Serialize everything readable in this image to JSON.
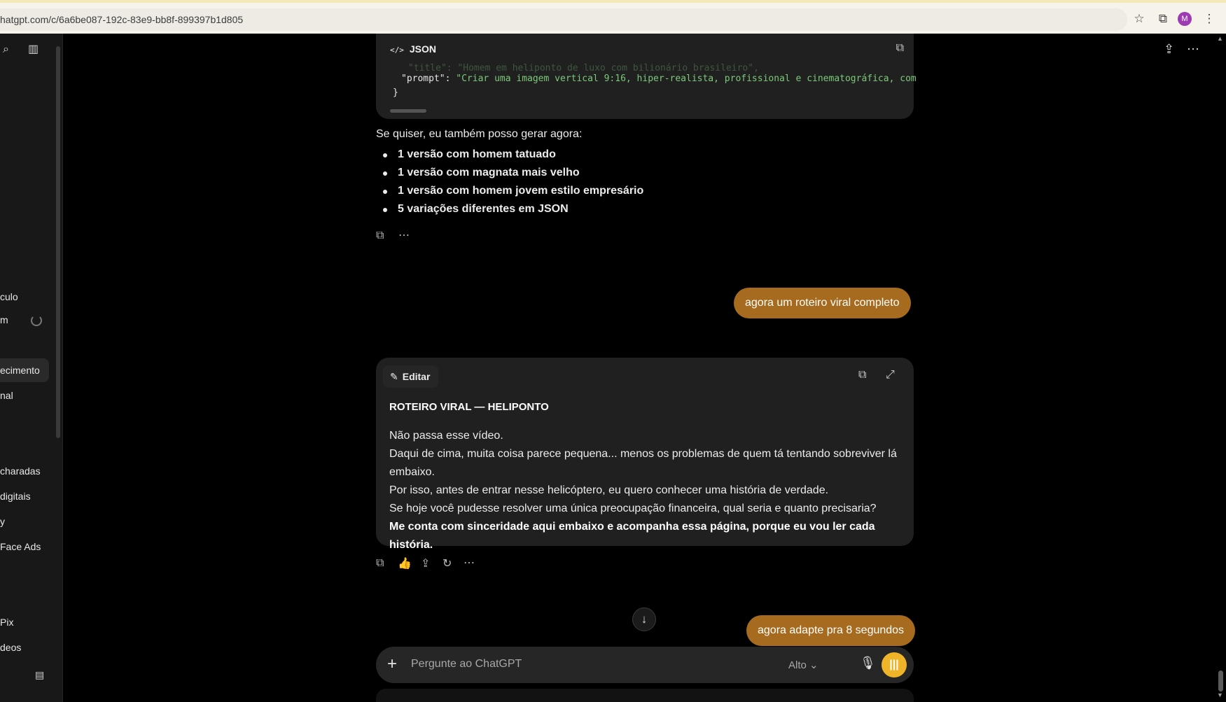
{
  "browser": {
    "url": "hatgpt.com/c/6a6be087-192c-83e9-bb8f-899397b1d805",
    "avatar_initial": "M",
    "icons": [
      "star-icon",
      "extensions-icon",
      "avatar",
      "kebab-menu-icon"
    ]
  },
  "sidebar": {
    "items": [
      {
        "label": "culo"
      },
      {
        "label": "m"
      },
      {
        "label": "ecimento"
      },
      {
        "label": "nal"
      },
      {
        "label": " charadas"
      },
      {
        "label": "digitais"
      },
      {
        "label": "y"
      },
      {
        "label": "Face Ads"
      },
      {
        "label": "Pix"
      },
      {
        "label": "deos"
      }
    ]
  },
  "code_block": {
    "language": "JSON",
    "line_faded": "\"title\": \"Homem em heliponto de luxo com bilionário brasileiro\",",
    "line_key": "\"prompt\"",
    "line_value": "\"Criar uma imagem vertical 9:16, hiper-realista, profissional e cinematográfica, com",
    "line_close": "}"
  },
  "assistant_text": {
    "intro": "Se quiser, eu também posso gerar agora:",
    "bullets": [
      "1 versão com homem tatuado",
      "1 versão com magnata mais velho",
      "1 versão com homem jovem estilo empresário",
      "5 variações diferentes em JSON"
    ]
  },
  "user_messages": [
    "agora um roteiro viral completo",
    "agora adapte pra 8 segundos"
  ],
  "canvas": {
    "edit_label": "Editar",
    "title": "ROTEIRO VIRAL — HELIPONTO",
    "lines": [
      "Não passa esse vídeo.",
      "Daqui de cima, muita coisa parece pequena... menos os problemas de quem tá tentando sobreviver lá embaixo.",
      "Por isso, antes de entrar nesse helicóptero, eu quero conhecer uma história de verdade.",
      "Se hoje você pudesse resolver uma única preocupação financeira, qual seria e quanto precisaria?"
    ],
    "closing": "Me conta com sinceridade aqui embaixo e acompanha essa página, porque eu vou ler cada história."
  },
  "composer": {
    "placeholder": "Pergunte ao ChatGPT",
    "model": "Alto"
  }
}
